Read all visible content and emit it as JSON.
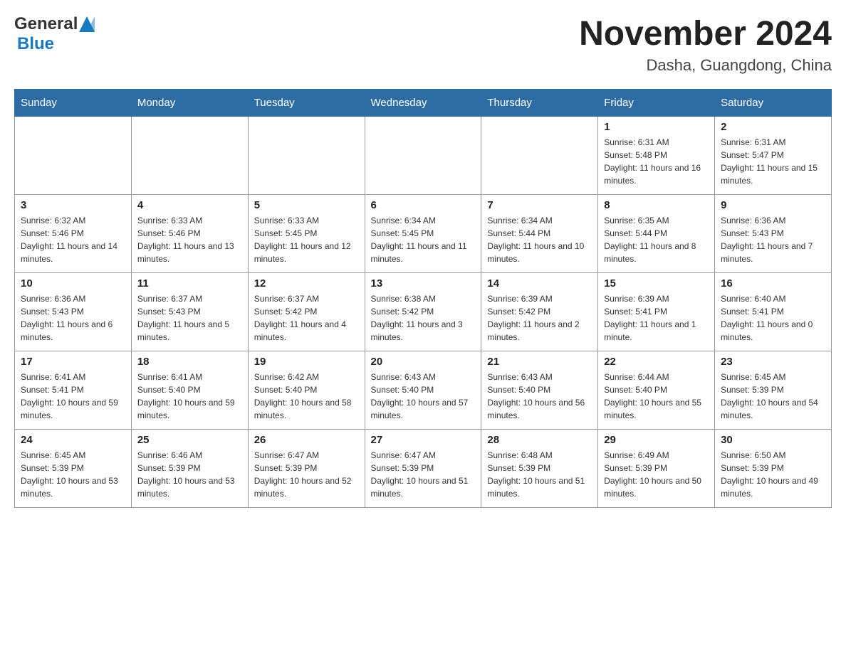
{
  "header": {
    "logo_general": "General",
    "logo_blue": "Blue",
    "month_title": "November 2024",
    "location": "Dasha, Guangdong, China"
  },
  "weekdays": [
    "Sunday",
    "Monday",
    "Tuesday",
    "Wednesday",
    "Thursday",
    "Friday",
    "Saturday"
  ],
  "weeks": [
    [
      {
        "day": "",
        "info": ""
      },
      {
        "day": "",
        "info": ""
      },
      {
        "day": "",
        "info": ""
      },
      {
        "day": "",
        "info": ""
      },
      {
        "day": "",
        "info": ""
      },
      {
        "day": "1",
        "info": "Sunrise: 6:31 AM\nSunset: 5:48 PM\nDaylight: 11 hours and 16 minutes."
      },
      {
        "day": "2",
        "info": "Sunrise: 6:31 AM\nSunset: 5:47 PM\nDaylight: 11 hours and 15 minutes."
      }
    ],
    [
      {
        "day": "3",
        "info": "Sunrise: 6:32 AM\nSunset: 5:46 PM\nDaylight: 11 hours and 14 minutes."
      },
      {
        "day": "4",
        "info": "Sunrise: 6:33 AM\nSunset: 5:46 PM\nDaylight: 11 hours and 13 minutes."
      },
      {
        "day": "5",
        "info": "Sunrise: 6:33 AM\nSunset: 5:45 PM\nDaylight: 11 hours and 12 minutes."
      },
      {
        "day": "6",
        "info": "Sunrise: 6:34 AM\nSunset: 5:45 PM\nDaylight: 11 hours and 11 minutes."
      },
      {
        "day": "7",
        "info": "Sunrise: 6:34 AM\nSunset: 5:44 PM\nDaylight: 11 hours and 10 minutes."
      },
      {
        "day": "8",
        "info": "Sunrise: 6:35 AM\nSunset: 5:44 PM\nDaylight: 11 hours and 8 minutes."
      },
      {
        "day": "9",
        "info": "Sunrise: 6:36 AM\nSunset: 5:43 PM\nDaylight: 11 hours and 7 minutes."
      }
    ],
    [
      {
        "day": "10",
        "info": "Sunrise: 6:36 AM\nSunset: 5:43 PM\nDaylight: 11 hours and 6 minutes."
      },
      {
        "day": "11",
        "info": "Sunrise: 6:37 AM\nSunset: 5:43 PM\nDaylight: 11 hours and 5 minutes."
      },
      {
        "day": "12",
        "info": "Sunrise: 6:37 AM\nSunset: 5:42 PM\nDaylight: 11 hours and 4 minutes."
      },
      {
        "day": "13",
        "info": "Sunrise: 6:38 AM\nSunset: 5:42 PM\nDaylight: 11 hours and 3 minutes."
      },
      {
        "day": "14",
        "info": "Sunrise: 6:39 AM\nSunset: 5:42 PM\nDaylight: 11 hours and 2 minutes."
      },
      {
        "day": "15",
        "info": "Sunrise: 6:39 AM\nSunset: 5:41 PM\nDaylight: 11 hours and 1 minute."
      },
      {
        "day": "16",
        "info": "Sunrise: 6:40 AM\nSunset: 5:41 PM\nDaylight: 11 hours and 0 minutes."
      }
    ],
    [
      {
        "day": "17",
        "info": "Sunrise: 6:41 AM\nSunset: 5:41 PM\nDaylight: 10 hours and 59 minutes."
      },
      {
        "day": "18",
        "info": "Sunrise: 6:41 AM\nSunset: 5:40 PM\nDaylight: 10 hours and 59 minutes."
      },
      {
        "day": "19",
        "info": "Sunrise: 6:42 AM\nSunset: 5:40 PM\nDaylight: 10 hours and 58 minutes."
      },
      {
        "day": "20",
        "info": "Sunrise: 6:43 AM\nSunset: 5:40 PM\nDaylight: 10 hours and 57 minutes."
      },
      {
        "day": "21",
        "info": "Sunrise: 6:43 AM\nSunset: 5:40 PM\nDaylight: 10 hours and 56 minutes."
      },
      {
        "day": "22",
        "info": "Sunrise: 6:44 AM\nSunset: 5:40 PM\nDaylight: 10 hours and 55 minutes."
      },
      {
        "day": "23",
        "info": "Sunrise: 6:45 AM\nSunset: 5:39 PM\nDaylight: 10 hours and 54 minutes."
      }
    ],
    [
      {
        "day": "24",
        "info": "Sunrise: 6:45 AM\nSunset: 5:39 PM\nDaylight: 10 hours and 53 minutes."
      },
      {
        "day": "25",
        "info": "Sunrise: 6:46 AM\nSunset: 5:39 PM\nDaylight: 10 hours and 53 minutes."
      },
      {
        "day": "26",
        "info": "Sunrise: 6:47 AM\nSunset: 5:39 PM\nDaylight: 10 hours and 52 minutes."
      },
      {
        "day": "27",
        "info": "Sunrise: 6:47 AM\nSunset: 5:39 PM\nDaylight: 10 hours and 51 minutes."
      },
      {
        "day": "28",
        "info": "Sunrise: 6:48 AM\nSunset: 5:39 PM\nDaylight: 10 hours and 51 minutes."
      },
      {
        "day": "29",
        "info": "Sunrise: 6:49 AM\nSunset: 5:39 PM\nDaylight: 10 hours and 50 minutes."
      },
      {
        "day": "30",
        "info": "Sunrise: 6:50 AM\nSunset: 5:39 PM\nDaylight: 10 hours and 49 minutes."
      }
    ]
  ]
}
